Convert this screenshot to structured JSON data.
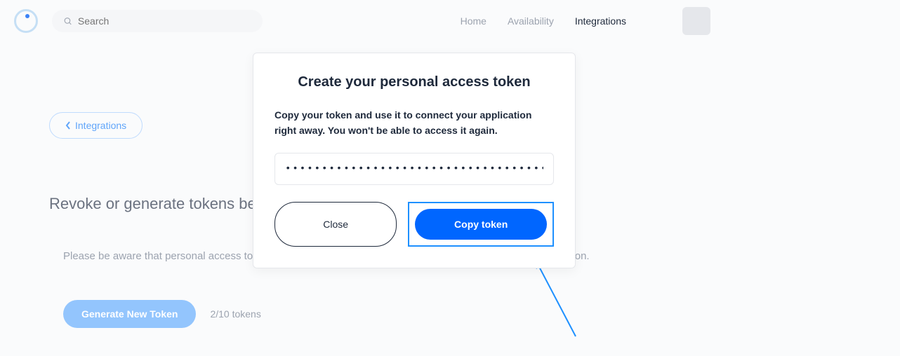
{
  "header": {
    "search_placeholder": "Search",
    "nav": {
      "home": "Home",
      "availability": "Availability",
      "integrations": "Integrations"
    }
  },
  "page": {
    "back_label": "Integrations",
    "title": "Revoke or generate tokens below",
    "description": "Please be aware that personal access tokens grant access to all Calendly data for everyone in your organization.",
    "generate_button": "Generate New Token",
    "token_count": "2/10 tokens"
  },
  "modal": {
    "title": "Create your personal access token",
    "description": "Copy your token and use it to connect your application right away. You won't be able to access it again.",
    "token_value": "••••••••••••••••••••••••••••••••••••••••••••••••",
    "close_label": "Close",
    "copy_label": "Copy token"
  }
}
